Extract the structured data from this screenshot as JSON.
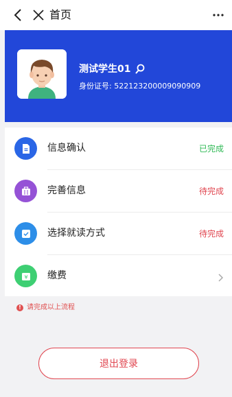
{
  "header": {
    "title": "首页",
    "back_icon": "chevron-left-icon",
    "close_icon": "close-icon",
    "more_icon": "more-dots-icon"
  },
  "profile": {
    "name": "测试学生01",
    "id_label": "身份证号:",
    "id_number": "522123200009090909",
    "background_color": "#2247d9",
    "search_icon": "search-icon"
  },
  "steps": [
    {
      "label": "信息确认",
      "status": "已完成",
      "status_color": "#2fb955",
      "icon": "document-icon",
      "icon_color": "#2a66e6"
    },
    {
      "label": "完善信息",
      "status": "待完成",
      "status_color": "#e0454f",
      "icon": "briefcase-icon",
      "icon_color": "#9552d6"
    },
    {
      "label": "选择就读方式",
      "status": "待完成",
      "status_color": "#e0454f",
      "icon": "checkbox-icon",
      "icon_color": "#2d8ee8"
    },
    {
      "label": "缴费",
      "status": "",
      "icon": "wallet-icon",
      "icon_color": "#3ecf73",
      "trailing_icon": "chevron-right-icon"
    }
  ],
  "notice": {
    "text": "请完成以上流程",
    "icon": "alert-icon",
    "icon_glyph": "!"
  },
  "logout": {
    "label": "退出登录",
    "color": "#e0454f"
  }
}
